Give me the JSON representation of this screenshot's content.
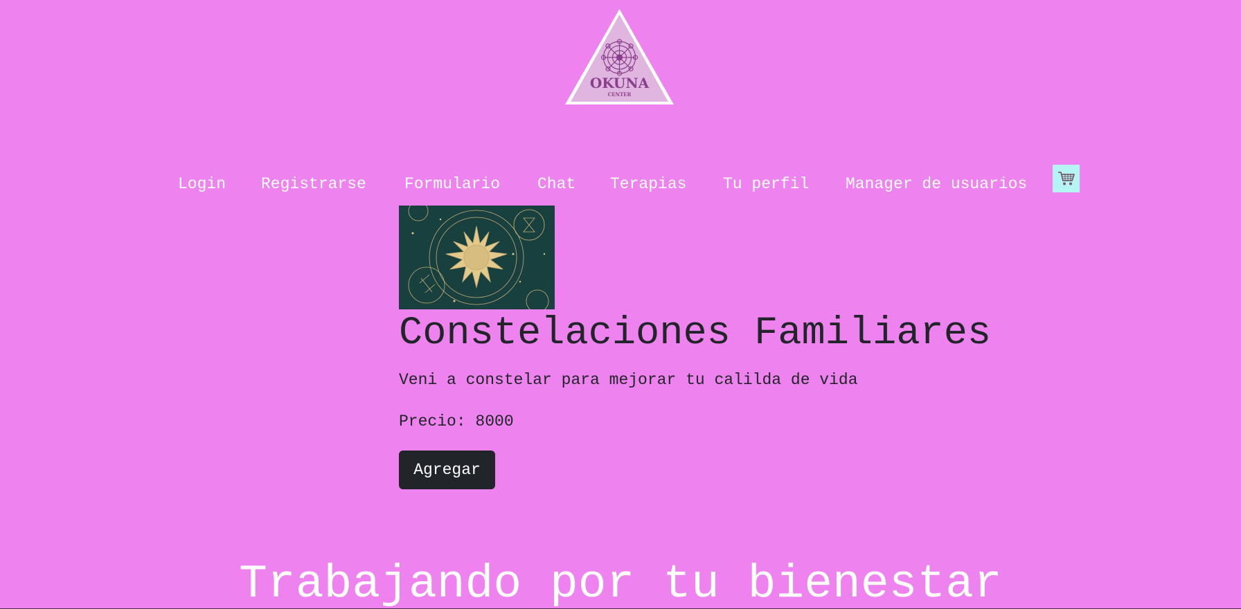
{
  "logo": {
    "brand": "OKUNA",
    "sub": "CENTER"
  },
  "nav": {
    "items": [
      {
        "label": "Login"
      },
      {
        "label": "Registrarse"
      },
      {
        "label": "Formulario"
      },
      {
        "label": "Chat"
      },
      {
        "label": "Terapias"
      },
      {
        "label": "Tu perfil"
      },
      {
        "label": "Manager de usuarios"
      }
    ],
    "cart_icon": "shopping-cart-icon"
  },
  "therapy": {
    "image_icon": "sun-celestial-illustration",
    "title": "Constelaciones Familiares",
    "description": "Veni a constelar para mejorar tu calilda de vida",
    "price_text": "Precio: 8000",
    "add_label": "Agregar"
  },
  "footer": {
    "title": "Trabajando por tu bienestar"
  },
  "colors": {
    "background": "#ee82ee",
    "button_dark": "#212529",
    "cart_bg": "#b5f4f4",
    "text_dark": "#212529",
    "logo_purple": "#8a3f8a"
  }
}
